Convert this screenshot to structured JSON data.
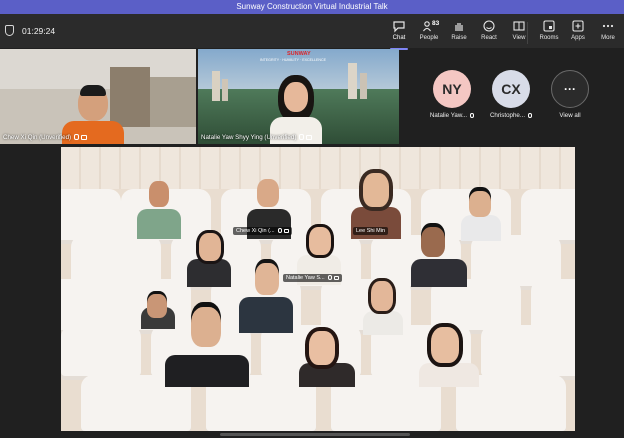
{
  "window": {
    "title": "Sunway Construction Virtual Industrial Talk"
  },
  "meeting": {
    "timer": "01:29:24"
  },
  "toolbar": {
    "chat": "Chat",
    "people": "People",
    "people_count": "83",
    "raise": "Raise",
    "react": "React",
    "view": "View",
    "rooms": "Rooms",
    "apps": "Apps",
    "more": "More"
  },
  "video_tiles": [
    {
      "name": "Chew Xi Qin (Unverified)"
    },
    {
      "name": "Natalie Yaw Shyy Ying (Unverified)"
    }
  ],
  "banner_text": {
    "logo": "SUNWAY",
    "tagline": "INTEGRITY · HUMILITY · EXCELLENCE"
  },
  "avatars": [
    {
      "initials": "NY",
      "name": "Natalie Yaw...",
      "color": "#f4c7c3"
    },
    {
      "initials": "CX",
      "name": "Christophe...",
      "color": "#d8dce8"
    },
    {
      "initials": "···",
      "name": "View all",
      "color": "#2b2b2b"
    }
  ],
  "together_mode": {
    "tags": [
      "Chew Xi Qin (...",
      "Lee Shi Min",
      "Natalie Yaw S..."
    ]
  }
}
